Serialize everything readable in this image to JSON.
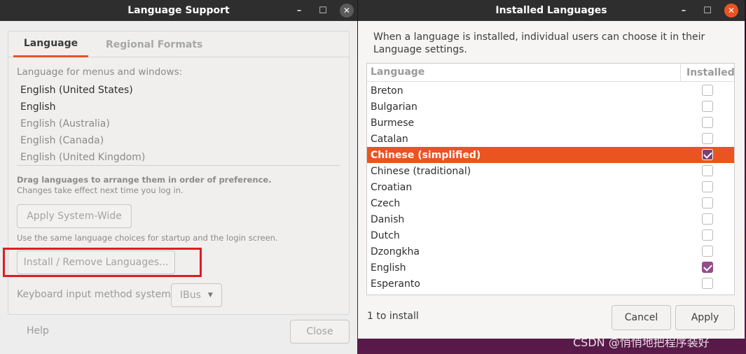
{
  "language_support": {
    "title": "Language Support",
    "controls": {
      "minimize": "–",
      "maximize": "☐",
      "close": "✕"
    },
    "tabs": [
      "Language",
      "Regional Formats"
    ],
    "menus_label": "Language for menus and windows:",
    "languages": [
      "English (United States)",
      "English",
      "English (Australia)",
      "English (Canada)",
      "English (United Kingdom)"
    ],
    "drag_note": "Drag languages to arrange them in order of preference.",
    "changes_note": "Changes take effect next time you log in.",
    "apply_system_wide": "Apply System-Wide",
    "same_note": "Use the same language choices for startup and the login screen.",
    "install_remove": "Install / Remove Languages...",
    "keyboard_label": "Keyboard input method system:",
    "keyboard_value": "IBus",
    "help": "Help",
    "close": "Close"
  },
  "installed_languages": {
    "title": "Installed Languages",
    "controls": {
      "minimize": "–",
      "maximize": "☐",
      "close": "✕"
    },
    "intro": "When a language is installed, individual users can choose it in their Language settings.",
    "columns": {
      "language": "Language",
      "installed": "Installed"
    },
    "rows": [
      {
        "name": "Breton",
        "installed": false
      },
      {
        "name": "Bulgarian",
        "installed": false
      },
      {
        "name": "Burmese",
        "installed": false
      },
      {
        "name": "Catalan",
        "installed": false
      },
      {
        "name": "Chinese (simplified)",
        "installed": true,
        "selected": true
      },
      {
        "name": "Chinese (traditional)",
        "installed": false
      },
      {
        "name": "Croatian",
        "installed": false
      },
      {
        "name": "Czech",
        "installed": false
      },
      {
        "name": "Danish",
        "installed": false
      },
      {
        "name": "Dutch",
        "installed": false
      },
      {
        "name": "Dzongkha",
        "installed": false
      },
      {
        "name": "English",
        "installed": true
      },
      {
        "name": "Esperanto",
        "installed": false
      }
    ],
    "status": "1 to install",
    "cancel": "Cancel",
    "apply": "Apply"
  },
  "watermark": "CSDN @悄悄地把程序装好",
  "colors": {
    "accent": "#e95420",
    "check": "#924d8b",
    "titlebar": "#2e2e2e"
  }
}
